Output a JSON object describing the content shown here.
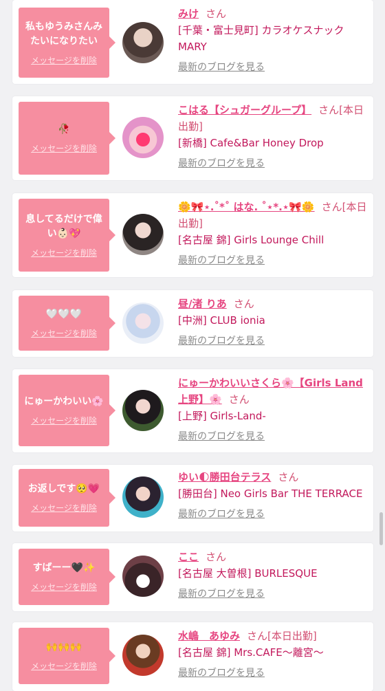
{
  "cards": [
    {
      "message": "私もゆうみさんみたいになりたい",
      "delete_label": "メッセージを削除",
      "name": "みけ",
      "suffix": "さん",
      "shop": "[千葉・富士見町] カラオケスナック MARY",
      "blog_label": "最新のブログを見る"
    },
    {
      "message": "🥀",
      "delete_label": "メッセージを削除",
      "name": "こはる【シュガーグループ】",
      "suffix": "さん[本日出勤]",
      "shop": "[新橋] Cafe&Bar Honey Drop",
      "blog_label": "最新のブログを見る"
    },
    {
      "message": "息してるだけで偉い👶🏻💖",
      "delete_label": "メッセージを削除",
      "name": "🌼🎀⋆.˚*˚ はな. ˚⋆*.⋆🎀🌼",
      "suffix": "さん[本日出勤]",
      "shop": "[名古屋 錦] Girls Lounge Chill",
      "blog_label": "最新のブログを見る"
    },
    {
      "message": "🤍🤍🤍",
      "delete_label": "メッセージを削除",
      "name": "昼/渚 りあ",
      "suffix": "さん",
      "shop": "[中洲] CLUB ionia",
      "blog_label": "最新のブログを見る"
    },
    {
      "message": "にゅーかわいい🌸",
      "delete_label": "メッセージを削除",
      "name": "にゅーかわいいさくら🌸【Girls Land 上野】🌸",
      "suffix": "さん",
      "shop": "[上野] Girls-Land-",
      "blog_label": "最新のブログを見る"
    },
    {
      "message": "お返しです🥺💗",
      "delete_label": "メッセージを削除",
      "name": "ゆい🌓勝田台テラス",
      "suffix": "さん",
      "shop": "[勝田台] Neo Girls Bar THE TERRACE",
      "blog_label": "最新のブログを見る"
    },
    {
      "message": "すばーー🖤✨",
      "delete_label": "メッセージを削除",
      "name": "ここ",
      "suffix": "さん",
      "shop": "[名古屋 大曽根] BURLESQUE",
      "blog_label": "最新のブログを見る"
    },
    {
      "message": "🙌🙌🙌",
      "delete_label": "メッセージを削除",
      "name": "水嶋　あゆみ",
      "suffix": "さん[本日出勤]",
      "shop": "[名古屋 錦] Mrs.CAFE〜離宮〜",
      "blog_label": "最新のブログを見る"
    }
  ],
  "colors": {
    "bubble": "#f68ea0",
    "name": "#e64580",
    "shop": "#c2185b",
    "blog": "#8a8a8a"
  }
}
